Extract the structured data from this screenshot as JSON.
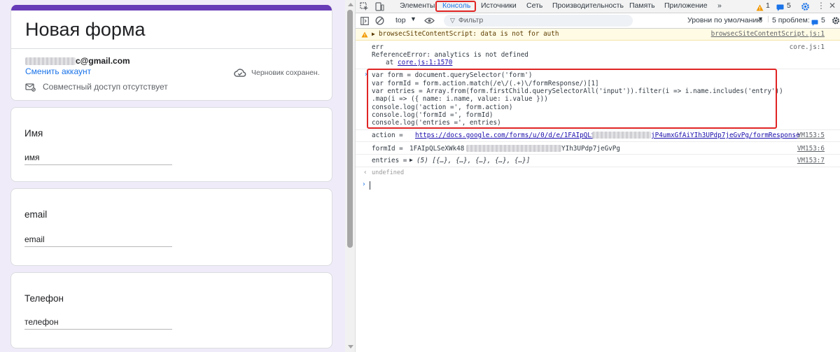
{
  "form": {
    "title": "Новая форма",
    "email_suffix": "c@gmail.com",
    "switch_account": "Сменить аккаунт",
    "draft_status": "Черновик сохранен.",
    "sharing_status": "Совместный доступ отсутствует",
    "questions": [
      {
        "title": "Имя",
        "value": "имя"
      },
      {
        "title": "email",
        "value": "email"
      },
      {
        "title": "Телефон",
        "value": "телефон"
      }
    ]
  },
  "devtools": {
    "tabs": [
      "Элементы",
      "Консоль",
      "Источники",
      "Сеть",
      "Производительность",
      "Память",
      "Приложение"
    ],
    "more_tabs": "»",
    "warn_count": "1",
    "msg_count": "5",
    "context": "top",
    "filter_placeholder": "Фильтр",
    "levels": "Уровни по умолчанию",
    "issues_label": "5 проблем:",
    "issues_count": "5",
    "warning": {
      "text": "browsecSiteContentScript: data is not for auth",
      "source": "browsecSiteContentScript.js:1"
    },
    "error": {
      "line1": "err",
      "line2": "ReferenceError: analytics is not defined",
      "line3_prefix": "at ",
      "line3_link": "core.js:1:1570",
      "source": "core.js:1"
    },
    "code": [
      "var form = document.querySelector('form')",
      "var formId = form.action.match(/e\\/(.+)\\/formResponse/)[1]",
      "var entries = Array.from(form.firstChild.querySelectorAll('input')).filter(i => i.name.includes('entry'))",
      ".map(i => ({ name: i.name, value: i.value }))",
      "console.log('action =', form.action)",
      "console.log('formId =', formId)",
      "console.log('entries =', entries)"
    ],
    "outputs": [
      {
        "prefix": "action = ",
        "url_start": "https://docs.google.com/forms/u/0/d/e/1FAIpQLSe",
        "url_end": "jP4umxGfAiYIh3UPdp7jeGvPg/formResponse",
        "source": "VM153:5"
      },
      {
        "prefix": "formId = ",
        "value_start": "1FAIpQLSeXWk48",
        "value_end": "YIh3UPdp7jeGvPg",
        "source": "VM153:6"
      },
      {
        "prefix": "entries = ",
        "value": "(5) [{…}, {…}, {…}, {…}, {…}]",
        "source": "VM153:7"
      }
    ],
    "result": "undefined"
  },
  "colors": {
    "accent": "#673ab7",
    "link": "#1a73e8",
    "highlight": "#e02424"
  }
}
